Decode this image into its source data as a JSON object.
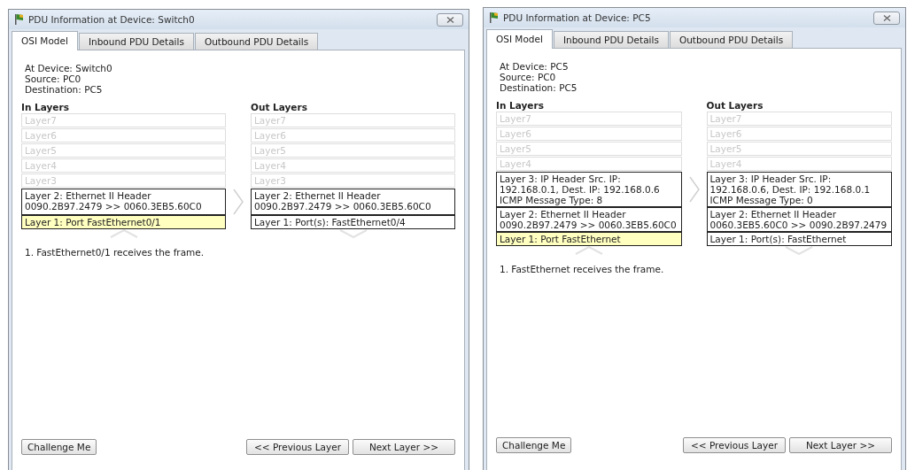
{
  "windows": [
    {
      "title": "PDU Information at Device: Switch0",
      "tabs": [
        {
          "label": "OSI Model",
          "selected": true
        },
        {
          "label": "Inbound PDU Details",
          "selected": false
        },
        {
          "label": "Outbound PDU Details",
          "selected": false
        }
      ],
      "info": [
        "At Device: Switch0",
        "Source: PC0",
        "Destination: PC5"
      ],
      "in_layers": {
        "heading": "In Layers",
        "layers": [
          {
            "lines": [
              "Layer7"
            ],
            "active": false,
            "selected": false
          },
          {
            "lines": [
              "Layer6"
            ],
            "active": false,
            "selected": false
          },
          {
            "lines": [
              "Layer5"
            ],
            "active": false,
            "selected": false
          },
          {
            "lines": [
              "Layer4"
            ],
            "active": false,
            "selected": false
          },
          {
            "lines": [
              "Layer3"
            ],
            "active": false,
            "selected": false
          },
          {
            "lines": [
              "Layer 2: Ethernet II Header",
              "0090.2B97.2479 >> 0060.3EB5.60C0"
            ],
            "active": true,
            "selected": false
          },
          {
            "lines": [
              "Layer 1: Port FastEthernet0/1"
            ],
            "active": true,
            "selected": true
          }
        ]
      },
      "out_layers": {
        "heading": "Out Layers",
        "layers": [
          {
            "lines": [
              "Layer7"
            ],
            "active": false,
            "selected": false
          },
          {
            "lines": [
              "Layer6"
            ],
            "active": false,
            "selected": false
          },
          {
            "lines": [
              "Layer5"
            ],
            "active": false,
            "selected": false
          },
          {
            "lines": [
              "Layer4"
            ],
            "active": false,
            "selected": false
          },
          {
            "lines": [
              "Layer3"
            ],
            "active": false,
            "selected": false
          },
          {
            "lines": [
              "Layer 2: Ethernet II Header",
              "0090.2B97.2479 >> 0060.3EB5.60C0"
            ],
            "active": true,
            "selected": false
          },
          {
            "lines": [
              "Layer 1: Port(s): FastEthernet0/4"
            ],
            "active": true,
            "selected": false
          }
        ]
      },
      "steps": [
        "1. FastEthernet0/1 receives the frame."
      ],
      "buttons": {
        "challenge": "Challenge Me",
        "previous": "<< Previous Layer",
        "next": "Next Layer >>"
      }
    },
    {
      "title": "PDU Information at Device: PC5",
      "tabs": [
        {
          "label": "OSI Model",
          "selected": true
        },
        {
          "label": "Inbound PDU Details",
          "selected": false
        },
        {
          "label": "Outbound PDU Details",
          "selected": false
        }
      ],
      "info": [
        "At Device: PC5",
        "Source: PC0",
        "Destination: PC5"
      ],
      "in_layers": {
        "heading": "In Layers",
        "layers": [
          {
            "lines": [
              "Layer7"
            ],
            "active": false,
            "selected": false
          },
          {
            "lines": [
              "Layer6"
            ],
            "active": false,
            "selected": false
          },
          {
            "lines": [
              "Layer5"
            ],
            "active": false,
            "selected": false
          },
          {
            "lines": [
              "Layer4"
            ],
            "active": false,
            "selected": false
          },
          {
            "lines": [
              "Layer 3: IP Header Src. IP:",
              "192.168.0.1, Dest. IP: 192.168.0.6",
              "ICMP Message Type: 8"
            ],
            "active": true,
            "selected": false
          },
          {
            "lines": [
              "Layer 2: Ethernet II Header",
              "0090.2B97.2479 >> 0060.3EB5.60C0"
            ],
            "active": true,
            "selected": false
          },
          {
            "lines": [
              "Layer 1: Port FastEthernet"
            ],
            "active": true,
            "selected": true
          }
        ]
      },
      "out_layers": {
        "heading": "Out Layers",
        "layers": [
          {
            "lines": [
              "Layer7"
            ],
            "active": false,
            "selected": false
          },
          {
            "lines": [
              "Layer6"
            ],
            "active": false,
            "selected": false
          },
          {
            "lines": [
              "Layer5"
            ],
            "active": false,
            "selected": false
          },
          {
            "lines": [
              "Layer4"
            ],
            "active": false,
            "selected": false
          },
          {
            "lines": [
              "Layer 3: IP Header Src. IP:",
              "192.168.0.6, Dest. IP: 192.168.0.1",
              "ICMP Message Type: 0"
            ],
            "active": true,
            "selected": false
          },
          {
            "lines": [
              "Layer 2: Ethernet II Header",
              "0060.3EB5.60C0 >> 0090.2B97.2479"
            ],
            "active": true,
            "selected": false
          },
          {
            "lines": [
              "Layer 1: Port(s): FastEthernet"
            ],
            "active": true,
            "selected": false
          }
        ]
      },
      "steps": [
        "1. FastEthernet receives the frame."
      ],
      "buttons": {
        "challenge": "Challenge Me",
        "previous": "<< Previous Layer",
        "next": "Next Layer >>"
      }
    }
  ]
}
